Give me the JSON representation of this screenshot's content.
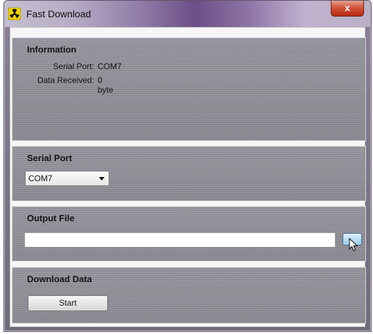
{
  "window": {
    "title": "Fast Download",
    "close_label": "x"
  },
  "information": {
    "title": "Information",
    "rows": [
      {
        "label": "Serial Port:",
        "value": "COM7"
      },
      {
        "label": "Data Received:",
        "value": "0 byte"
      }
    ]
  },
  "serial_port": {
    "title": "Serial Port",
    "selected": "COM7"
  },
  "output_file": {
    "title": "Output File",
    "value": "",
    "browse_label": ""
  },
  "download": {
    "title": "Download Data",
    "start_label": "Start"
  },
  "colors": {
    "panel": "#8f8c95",
    "close_button": "#c8442b",
    "browse_button": "#b8dcf4"
  },
  "icons": {
    "app": "radiation-icon",
    "close": "close-icon",
    "dropdown": "chevron-down-icon",
    "cursor": "mouse-pointer-icon"
  }
}
